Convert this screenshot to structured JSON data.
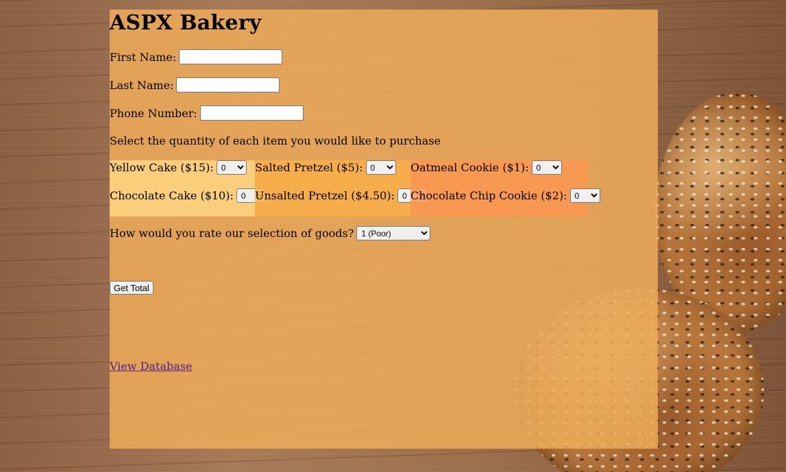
{
  "page": {
    "title": "ASPX Bakery"
  },
  "form": {
    "first_name": {
      "label": "First Name:",
      "value": ""
    },
    "last_name": {
      "label": "Last Name:",
      "value": ""
    },
    "phone": {
      "label": "Phone Number:",
      "value": ""
    },
    "instructions": "Select the quantity of each item you would like to purchase"
  },
  "goods": {
    "cakes": [
      {
        "label": "Yellow Cake ($15):",
        "quantity": "0"
      },
      {
        "label": "Chocolate Cake ($10):",
        "quantity": "0"
      }
    ],
    "pretzels": [
      {
        "label": "Salted Pretzel ($5):",
        "quantity": "0"
      },
      {
        "label": "Unsalted Pretzel ($4.50):",
        "quantity": "0"
      }
    ],
    "cookies": [
      {
        "label": "Oatmeal Cookie ($1):",
        "quantity": "0"
      },
      {
        "label": "Chocolate Chip Cookie ($2):",
        "quantity": "0"
      }
    ]
  },
  "rating": {
    "label": "How would you rate our selection of goods?",
    "selected": "1 (Poor)"
  },
  "actions": {
    "get_total_label": "Get Total",
    "view_database_label": "View Database"
  },
  "colors": {
    "panel": "#ecaa5a",
    "cakes_bg": "#ffd682",
    "pretzels_bg": "#faaf46",
    "cookies_bg": "#fc9650",
    "link": "#551a8b"
  }
}
